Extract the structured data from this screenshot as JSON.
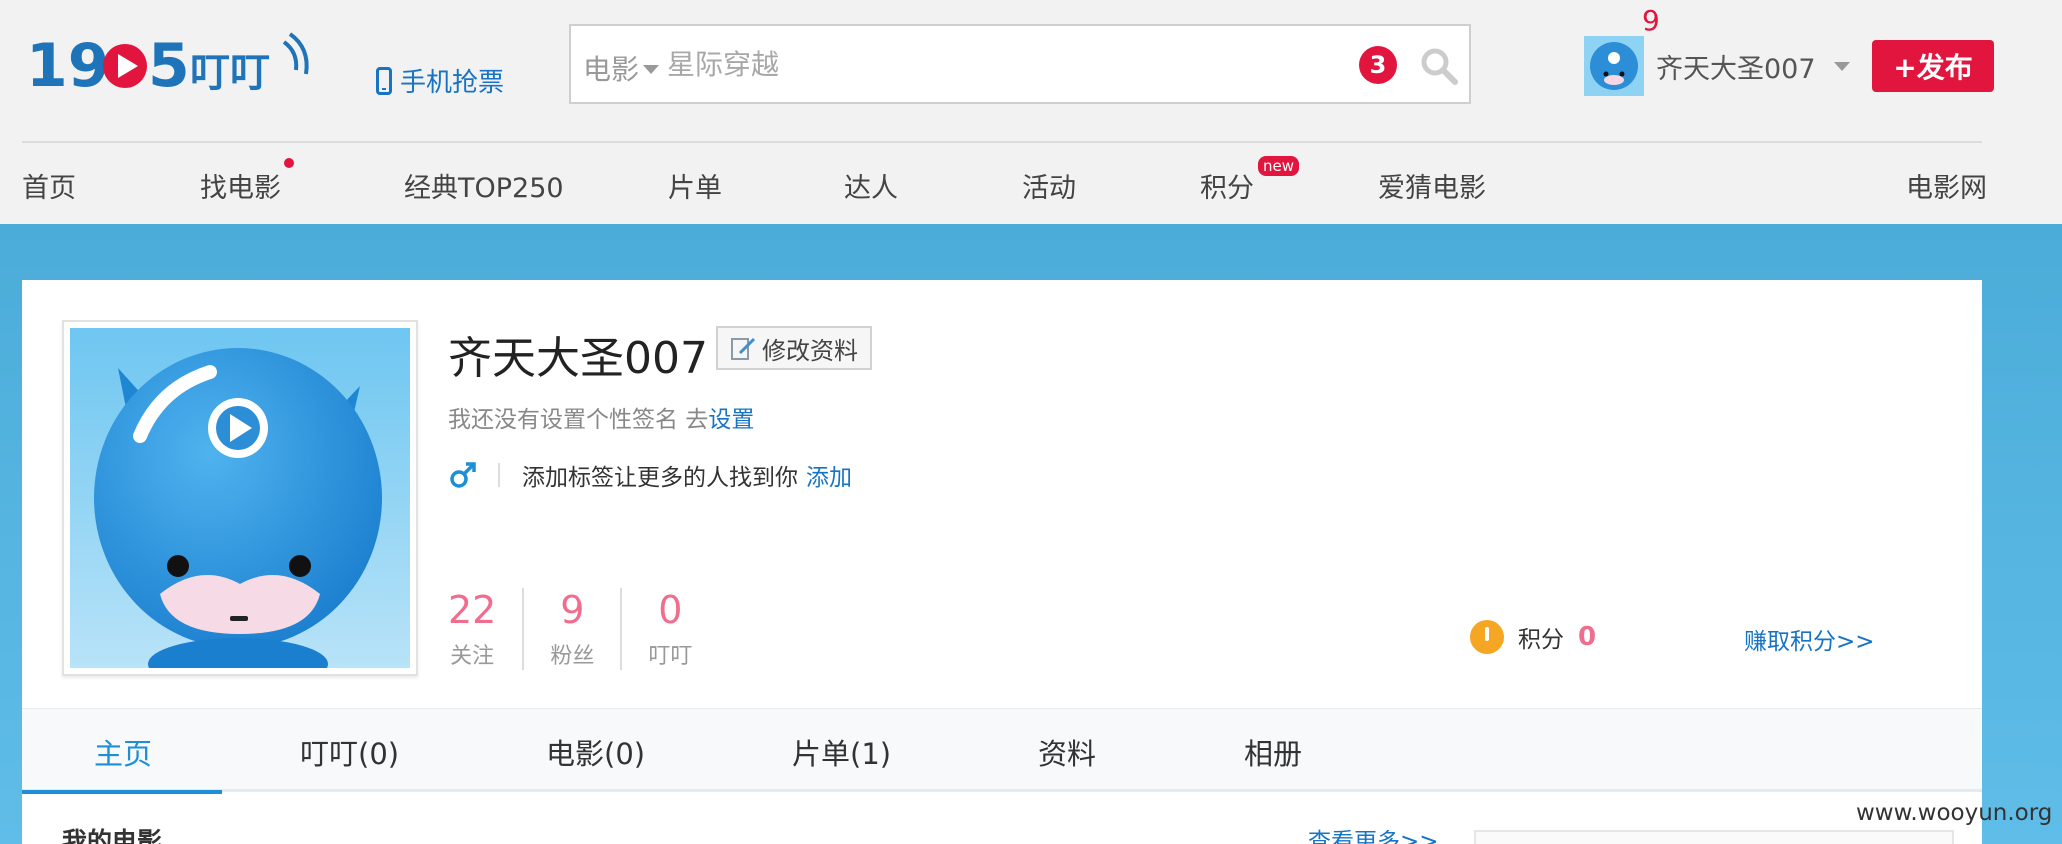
{
  "header": {
    "mobile_ticket": "手机抢票",
    "search": {
      "category": "电影",
      "placeholder": "星际穿越",
      "badge": "3"
    },
    "user": {
      "notice_count": "9",
      "name": "齐天大圣007"
    },
    "publish_label": "+发布"
  },
  "nav": {
    "items": [
      {
        "label": "首页"
      },
      {
        "label": "找电影"
      },
      {
        "label": "经典TOP250"
      },
      {
        "label": "片单"
      },
      {
        "label": "达人"
      },
      {
        "label": "活动"
      },
      {
        "label": "积分"
      },
      {
        "label": "爱猜电影"
      },
      {
        "label": "电影网"
      }
    ],
    "new_badge": "new"
  },
  "profile": {
    "name": "齐天大圣007",
    "edit_label": "修改资料",
    "signature_text": "我还没有设置个性签名 去",
    "signature_link": "设置",
    "tags_text": "添加标签让更多的人找到你",
    "tags_link": "添加",
    "stats": [
      {
        "value": "22",
        "label": "关注"
      },
      {
        "value": "9",
        "label": "粉丝"
      },
      {
        "value": "0",
        "label": "叮叮"
      }
    ],
    "points_label": "积分",
    "points_value": "0",
    "earn_points": "赚取积分>>"
  },
  "tabs": [
    {
      "label": "主页"
    },
    {
      "label": "叮叮(0)"
    },
    {
      "label": "电影(0)"
    },
    {
      "label": "片单(1)"
    },
    {
      "label": "资料"
    },
    {
      "label": "相册"
    }
  ],
  "content": {
    "section_title": "我的电影",
    "more_link": "查看更多>>"
  },
  "watermark": "www.wooyun.org",
  "colors": {
    "brand_blue": "#1774c4",
    "brand_red": "#e1153d",
    "stat_pink": "#f06d8e",
    "banner_blue": "#5fbde8"
  }
}
